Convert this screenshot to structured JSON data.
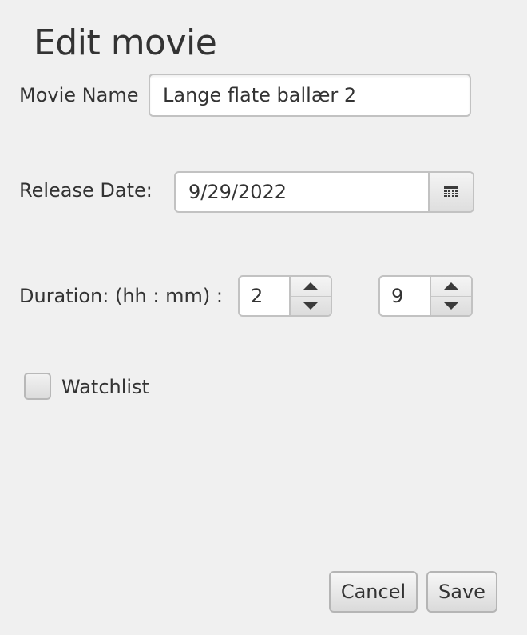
{
  "dialog": {
    "title": "Edit movie"
  },
  "form": {
    "movie_name": {
      "label": "Movie Name",
      "value": "Lange flate ballær 2"
    },
    "release_date": {
      "label": "Release Date:",
      "value": "9/29/2022",
      "button_icon": "calendar-icon"
    },
    "duration": {
      "label": "Duration: (hh : mm) :",
      "hours": "2",
      "minutes": "9"
    },
    "watchlist": {
      "label": "Watchlist",
      "checked": false
    }
  },
  "actions": {
    "cancel_label": "Cancel",
    "save_label": "Save"
  }
}
